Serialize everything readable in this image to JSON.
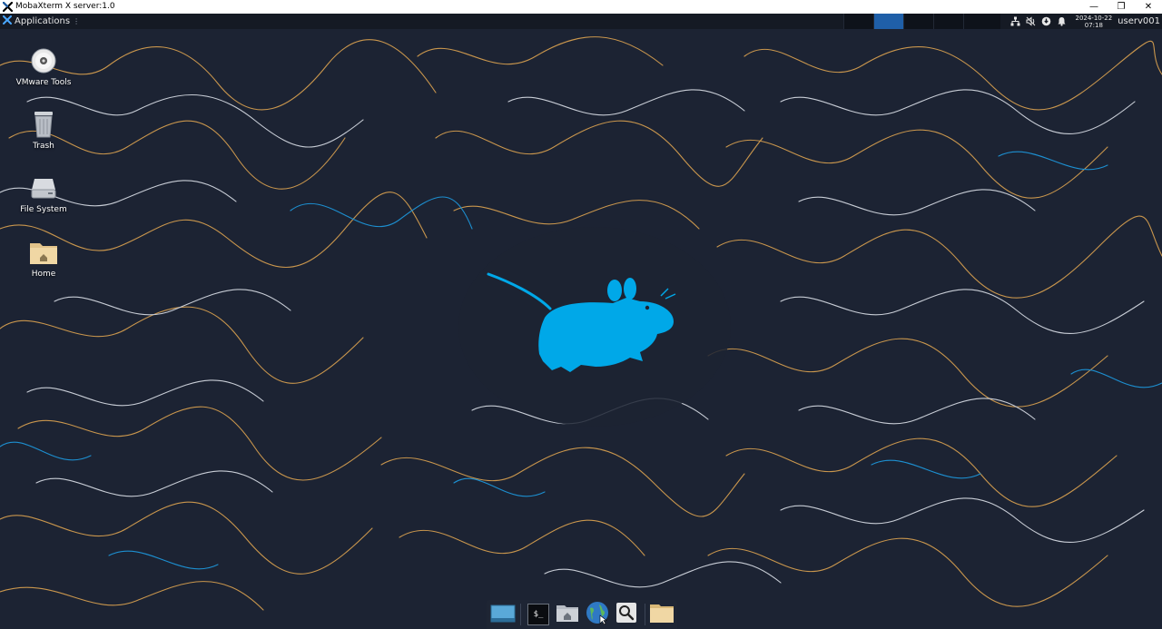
{
  "window": {
    "title": "MobaXterm X server:1.0",
    "minimize_glyph": "—",
    "restore_glyph": "❐",
    "close_glyph": "✕"
  },
  "panel": {
    "applications_label": "Applications",
    "applications_dots": "⋮",
    "workspaces": [
      {
        "active": false
      },
      {
        "active": true
      },
      {
        "active": false
      },
      {
        "active": false
      }
    ],
    "tray_icons": [
      "network-icon",
      "mute-icon",
      "update-icon",
      "notification-bell-icon"
    ],
    "clock": {
      "date": "2024-10-22",
      "time": "07:18"
    },
    "user": "userv001"
  },
  "desktop": {
    "icons": [
      {
        "name": "vmware-tools-icon",
        "label": "VMware Tools"
      },
      {
        "name": "trash-icon",
        "label": "Trash"
      },
      {
        "name": "file-system-icon",
        "label": "File System"
      },
      {
        "name": "home-folder-icon",
        "label": "Home"
      }
    ],
    "wallpaper": "xfce-mouse-topographic",
    "accent_color": "#00a8e8"
  },
  "dock": {
    "items": [
      "show-desktop-icon",
      "terminal-icon",
      "file-manager-home-icon",
      "web-browser-icon",
      "app-finder-search-icon",
      "folder-icon"
    ],
    "terminal_glyph": "$_"
  }
}
